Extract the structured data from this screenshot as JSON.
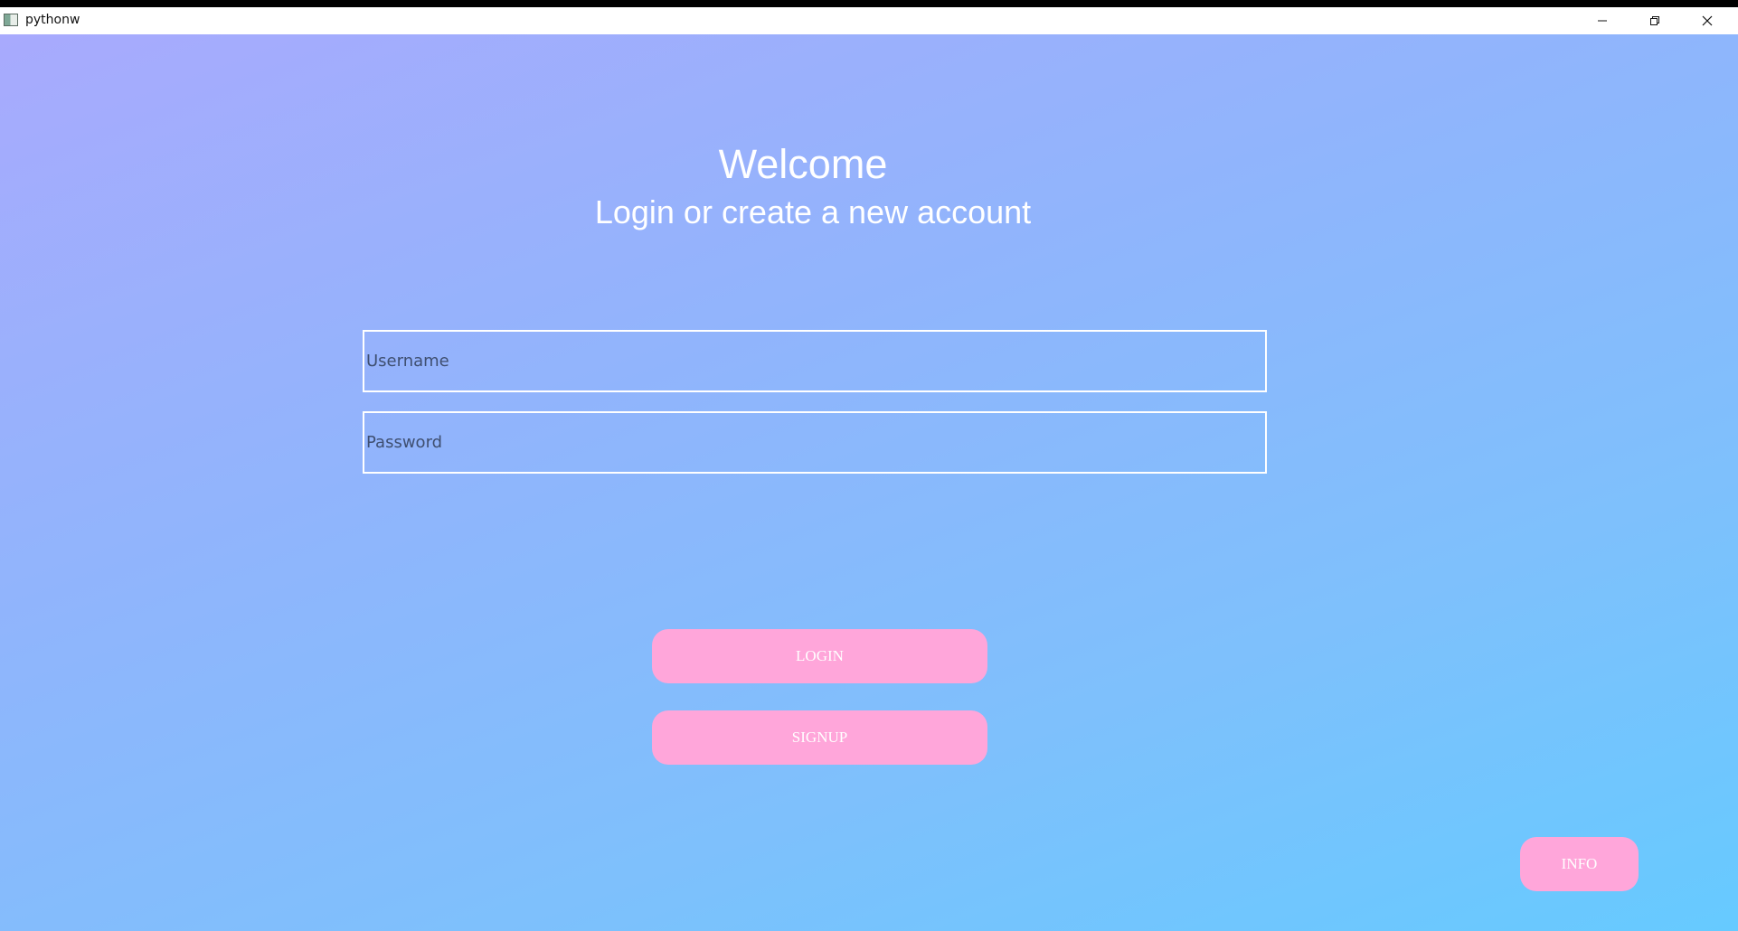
{
  "window": {
    "title": "pythonw",
    "controls": {
      "minimize_icon": "minimize-icon",
      "maximize_icon": "restore-icon",
      "close_icon": "close-icon"
    }
  },
  "header": {
    "title": "Welcome",
    "subtitle": "Login or create a new account"
  },
  "form": {
    "username": {
      "value": "",
      "placeholder": "Username"
    },
    "password": {
      "value": "",
      "placeholder": "Password"
    }
  },
  "buttons": {
    "login": "LOGIN",
    "signup": "SIGNUP",
    "info": "INFO"
  },
  "colors": {
    "gradient_start": "#a8aafd",
    "gradient_end": "#66caff",
    "button": "#ffa6da",
    "text": "#ffffff"
  }
}
